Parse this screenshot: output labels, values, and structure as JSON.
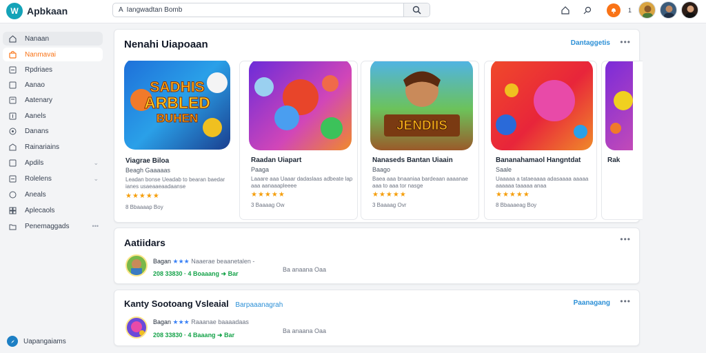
{
  "app": {
    "logo_text": "W",
    "name": "Apbkaan"
  },
  "search": {
    "value": "A  Iangwadtan Bomb",
    "placeholder": "Search"
  },
  "header": {
    "notifications": "1",
    "badge_icon": "bell-icon"
  },
  "sidebar": {
    "items": [
      {
        "label": "Nanaan",
        "icon": "home-icon"
      },
      {
        "label": "Nanmavai",
        "icon": "store-icon",
        "active": true
      },
      {
        "label": "Rpdriaes",
        "icon": "square-icon"
      },
      {
        "label": "Aanao",
        "icon": "square-icon"
      },
      {
        "label": "Aatenary",
        "icon": "square-icon"
      },
      {
        "label": "Aanels",
        "icon": "square-icon"
      },
      {
        "label": "Danans",
        "icon": "circle-icon"
      },
      {
        "label": "Rainariains",
        "icon": "building-icon"
      },
      {
        "label": "Apdils",
        "icon": "square-icon",
        "chevron": true
      },
      {
        "label": "Rolelens",
        "icon": "square-icon",
        "chevron": true
      },
      {
        "label": "Aneals",
        "icon": "circle-icon"
      },
      {
        "label": "Aplecaols",
        "icon": "grid-icon"
      },
      {
        "label": "Penemaggads",
        "icon": "folder-icon",
        "more": true
      }
    ],
    "bottom_label": "Uapangaiams"
  },
  "featured": {
    "title": "Nenahi Uiapoaan",
    "link": "Dantaggetis",
    "cards": [
      {
        "title": "Viagrae Biloa",
        "sub": "Beagh Gaaaaas",
        "desc": "Leadan bonse Ueadab to bearan baedar ianes usaeaaeaadaanse",
        "stars": "★★★★★",
        "meta": "8 Bbaaaap Boy"
      },
      {
        "title": "Raadan Uiapart",
        "sub": "Paaga",
        "desc": "Laaare aaa Uaaar dadaslaas adbeate lap aaa aanaaapleeee",
        "stars": "★★★★★",
        "meta": "3 Baaaag Ow"
      },
      {
        "title": "Nanaseds Bantan Uiaain",
        "sub": "Baago",
        "desc": "Baea aaa bnaaniaa bardeaan aaaanae aaa to aaa tor nasge",
        "stars": "★★★★★",
        "meta": "3 Baaaag Ovr"
      },
      {
        "title": "Bananahamaol Hangntdat",
        "sub": "Saale",
        "desc": "Uaaaaa a tataeaaaa adasaaaa aaaaa aaaaaa taaaaa anaa",
        "stars": "★★★★★",
        "meta": "8 Bbaaaeag Boy"
      },
      {
        "title": "Rak",
        "sub": "",
        "desc": "",
        "stars": "",
        "meta": ""
      }
    ]
  },
  "section2": {
    "title": "Aatiidars",
    "row": {
      "name": "Bagan",
      "stars": "★★★",
      "desc": "Naaerae beaanetalen -",
      "sub": "208 33830  ·  4  Boaaang  ➜ Bar",
      "extra": "Ba anaana Oaa"
    }
  },
  "section3": {
    "title": "Kanty Sootoang  Vsleaial",
    "subtitle": "Barpaaanagrah",
    "link": "Paanagang",
    "row": {
      "name": "Bagan",
      "stars": "★★★",
      "desc": "Raaanae baaaadaas",
      "sub": "208 33830  ·  4  Baaang  ➜ Bar",
      "extra": "Ba anaana Oaa"
    }
  },
  "colors": {
    "accent": "#f97316",
    "link": "#2b8fd6",
    "logo": "#14a3b8"
  }
}
